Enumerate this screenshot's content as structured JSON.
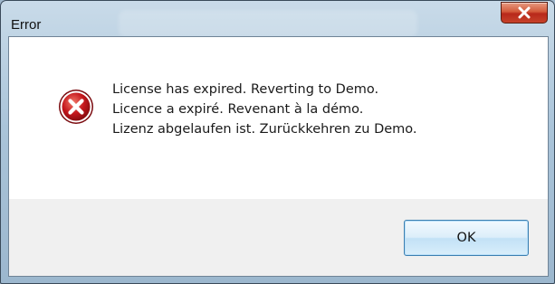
{
  "window": {
    "title": "Error"
  },
  "titlebar": {
    "close_icon": "close-icon",
    "close_color": "#c6422a"
  },
  "message": {
    "icon": "error-icon",
    "icon_color": "#c4161c",
    "lines": [
      "License has expired. Reverting to Demo.",
      "Licence a expiré. Revenant à la démo.",
      "Lizenz abgelaufen ist. Zurückkehren zu Demo."
    ]
  },
  "buttons": {
    "ok_label": "OK"
  }
}
